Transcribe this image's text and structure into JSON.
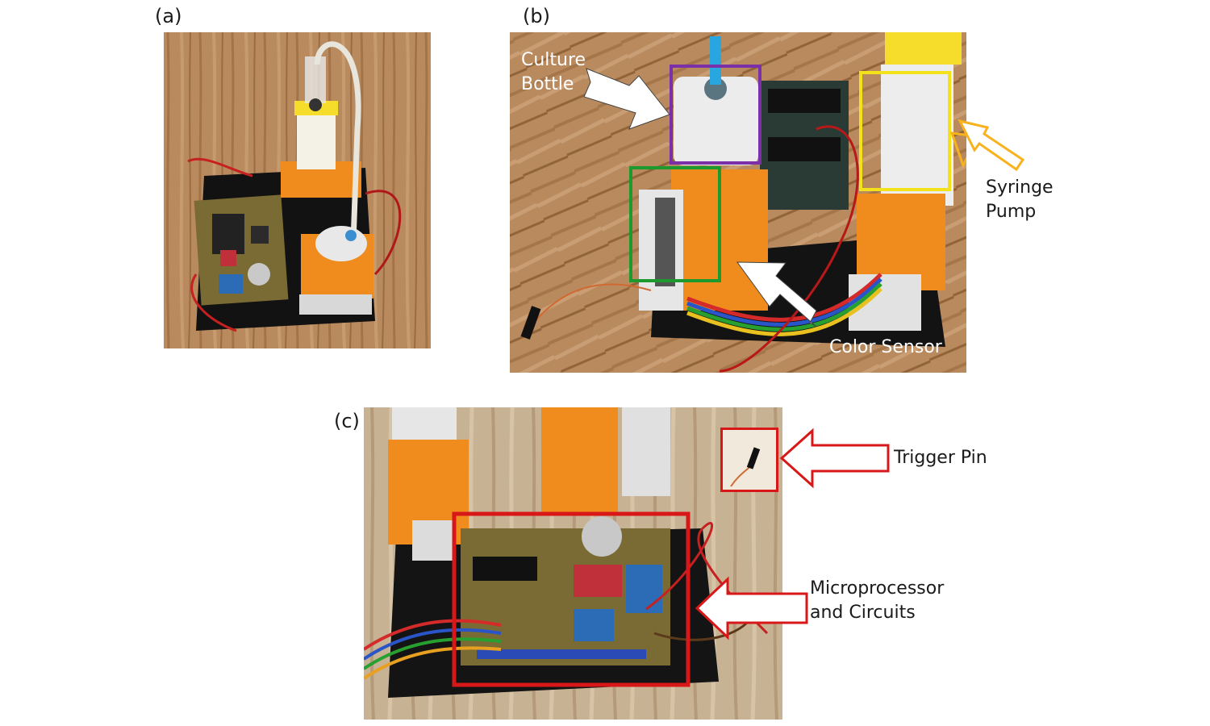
{
  "panels": {
    "a": {
      "label": "(a)"
    },
    "b": {
      "label": "(b)",
      "culture_bottle": [
        "Culture",
        "Bottle"
      ],
      "color_sensor": "Color Sensor",
      "syringe_pump": [
        "Syringe",
        "Pump"
      ]
    },
    "c": {
      "label": "(c)",
      "trigger_pin": "Trigger Pin",
      "microprocessor": [
        "Microprocessor",
        "and Circuits"
      ]
    }
  },
  "colors": {
    "wood": "#b98a5e",
    "wood_dark": "#8f6440",
    "orange_print": "#f08c1e",
    "pcb": "#7a6a34",
    "callout_purple": "#7b2fa8",
    "callout_green": "#1d9a2e",
    "callout_yellow": "#f3e21a",
    "callout_orange": "#f7b21e",
    "callout_red": "#d81818"
  }
}
